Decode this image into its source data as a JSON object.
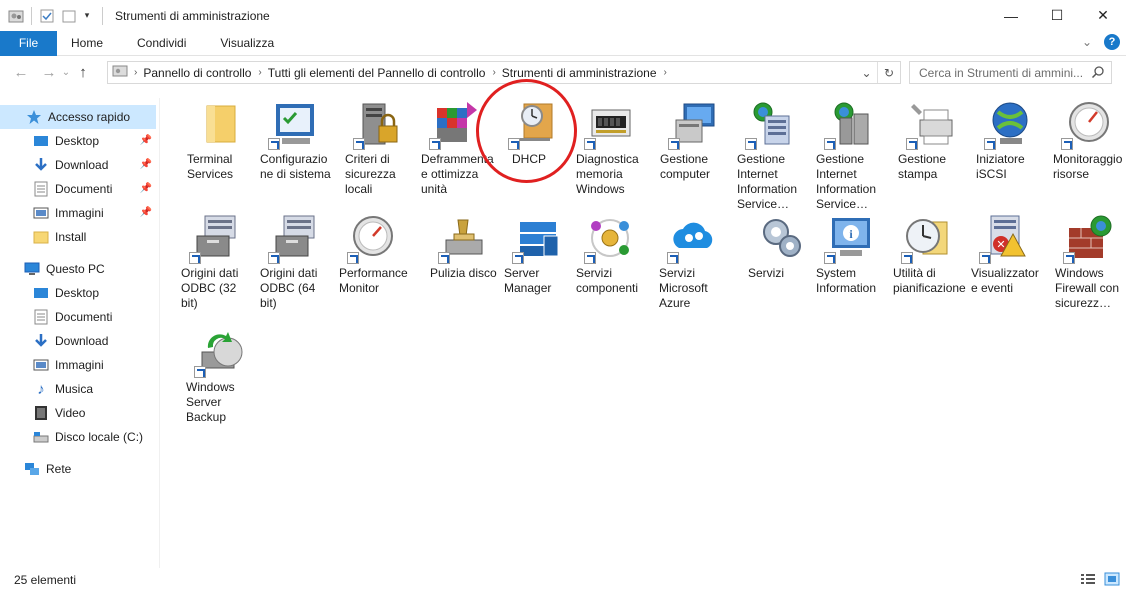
{
  "window": {
    "title": "Strumenti di amministrazione",
    "controls": {
      "minimize": "—",
      "maximize": "☐",
      "close": "✕"
    }
  },
  "ribbon": {
    "tabs": [
      "File",
      "Home",
      "Condividi",
      "Visualizza"
    ],
    "collapse_glyph": "⌄",
    "help_glyph": "?"
  },
  "navigation": {
    "back_glyph": "←",
    "forward_glyph": "→",
    "recent_glyph": "⌄",
    "up_glyph": "↑",
    "breadcrumb": [
      "Pannello di controllo",
      "Tutti gli elementi del Pannello di controllo",
      "Strumenti di amministrazione"
    ],
    "dropdown_glyph": "⌄",
    "refresh_glyph": "↻",
    "search_placeholder": "Cerca in Strumenti di ammini..."
  },
  "sidebar": {
    "quick_access": {
      "label": "Accesso rapido",
      "items": [
        {
          "label": "Desktop",
          "icon": "desktop-icon",
          "pinned": true
        },
        {
          "label": "Download",
          "icon": "download-icon",
          "pinned": true
        },
        {
          "label": "Documenti",
          "icon": "documents-icon",
          "pinned": true
        },
        {
          "label": "Immagini",
          "icon": "pictures-icon",
          "pinned": true
        },
        {
          "label": "Install",
          "icon": "folder-icon",
          "pinned": false
        }
      ]
    },
    "this_pc": {
      "label": "Questo PC",
      "items": [
        {
          "label": "Desktop",
          "icon": "desktop-icon"
        },
        {
          "label": "Documenti",
          "icon": "documents-icon"
        },
        {
          "label": "Download",
          "icon": "download-icon"
        },
        {
          "label": "Immagini",
          "icon": "pictures-icon"
        },
        {
          "label": "Musica",
          "icon": "music-icon"
        },
        {
          "label": "Video",
          "icon": "video-icon"
        },
        {
          "label": "Disco locale (C:)",
          "icon": "drive-icon"
        }
      ]
    },
    "network": {
      "label": "Rete"
    }
  },
  "items": [
    {
      "label": "Terminal Services",
      "icon": "folder-icon"
    },
    {
      "label": "Configurazione di sistema",
      "icon": "msconfig-icon"
    },
    {
      "label": "Criteri di sicurezza locali",
      "icon": "security-policy-icon"
    },
    {
      "label": "Deframmenta e ottimizza unità",
      "icon": "defrag-icon"
    },
    {
      "label": "DHCP",
      "icon": "dhcp-icon"
    },
    {
      "label": "Diagnostica memoria Windows",
      "icon": "memory-icon"
    },
    {
      "label": "Gestione computer",
      "icon": "computer-management-icon"
    },
    {
      "label": "Gestione Internet Information Service…",
      "icon": "iis-icon"
    },
    {
      "label": "Gestione Internet Information Service…",
      "icon": "iis6-icon"
    },
    {
      "label": "Gestione stampa",
      "icon": "print-management-icon"
    },
    {
      "label": "Iniziatore iSCSI",
      "icon": "iscsi-icon"
    },
    {
      "label": "Monitoraggio risorse",
      "icon": "resource-monitor-icon"
    },
    {
      "label": "Origini dati ODBC (32 bit)",
      "icon": "odbc-icon"
    },
    {
      "label": "Origini dati ODBC (64 bit)",
      "icon": "odbc-icon"
    },
    {
      "label": "Performance Monitor",
      "icon": "performance-icon"
    },
    {
      "label": "Pulizia disco",
      "icon": "disk-cleanup-icon"
    },
    {
      "label": "Server Manager",
      "icon": "server-manager-icon"
    },
    {
      "label": "Servizi componenti",
      "icon": "component-services-icon"
    },
    {
      "label": "Servizi Microsoft Azure",
      "icon": "azure-icon"
    },
    {
      "label": "Servizi",
      "icon": "services-icon"
    },
    {
      "label": "System Information",
      "icon": "system-info-icon"
    },
    {
      "label": "Utilità di pianificazione",
      "icon": "scheduler-icon"
    },
    {
      "label": "Visualizzatore eventi",
      "icon": "event-viewer-icon"
    },
    {
      "label": "Windows Firewall con sicurezz…",
      "icon": "firewall-icon"
    },
    {
      "label": "Windows Server Backup",
      "icon": "backup-icon"
    }
  ],
  "status": {
    "count": "25 elementi"
  }
}
